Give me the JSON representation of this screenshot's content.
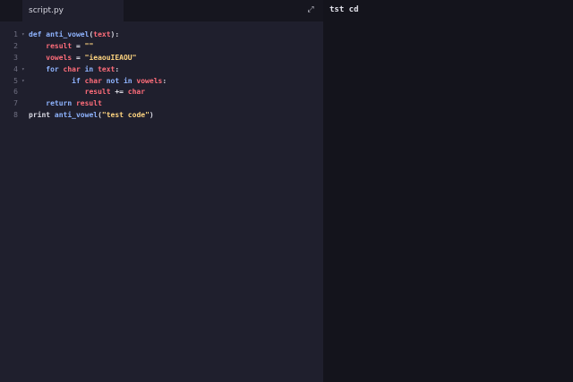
{
  "editor": {
    "tab_label": "script.py",
    "lines": [
      {
        "num": "1",
        "fold": "▾",
        "indent": 0,
        "tokens": [
          {
            "t": "def ",
            "c": "kw"
          },
          {
            "t": "anti_vowel",
            "c": "fn"
          },
          {
            "t": "(",
            "c": "plain"
          },
          {
            "t": "text",
            "c": "var"
          },
          {
            "t": "):",
            "c": "plain"
          }
        ]
      },
      {
        "num": "2",
        "fold": "",
        "indent": 4,
        "tokens": [
          {
            "t": "result",
            "c": "var"
          },
          {
            "t": " = ",
            "c": "op"
          },
          {
            "t": "\"\"",
            "c": "str"
          }
        ]
      },
      {
        "num": "3",
        "fold": "",
        "indent": 4,
        "tokens": [
          {
            "t": "vowels",
            "c": "var"
          },
          {
            "t": " = ",
            "c": "op"
          },
          {
            "t": "\"ieaouIEAOU\"",
            "c": "str"
          }
        ]
      },
      {
        "num": "4",
        "fold": "▾",
        "indent": 4,
        "tokens": [
          {
            "t": "for ",
            "c": "kw"
          },
          {
            "t": "char",
            "c": "var"
          },
          {
            "t": " in ",
            "c": "kw"
          },
          {
            "t": "text",
            "c": "var"
          },
          {
            "t": ":",
            "c": "plain"
          }
        ]
      },
      {
        "num": "5",
        "fold": "▾",
        "indent": 10,
        "tokens": [
          {
            "t": "if ",
            "c": "kw"
          },
          {
            "t": "char",
            "c": "var"
          },
          {
            "t": " not in ",
            "c": "kw"
          },
          {
            "t": "vowels",
            "c": "var"
          },
          {
            "t": ":",
            "c": "plain"
          }
        ]
      },
      {
        "num": "6",
        "fold": "",
        "indent": 13,
        "tokens": [
          {
            "t": "result",
            "c": "var"
          },
          {
            "t": " += ",
            "c": "op"
          },
          {
            "t": "char",
            "c": "var"
          }
        ]
      },
      {
        "num": "7",
        "fold": "",
        "indent": 4,
        "tokens": [
          {
            "t": "return ",
            "c": "kw"
          },
          {
            "t": "result",
            "c": "var"
          }
        ]
      },
      {
        "num": "8",
        "fold": "",
        "indent": 0,
        "tokens": [
          {
            "t": "print ",
            "c": "plain"
          },
          {
            "t": "anti_vowel",
            "c": "fn"
          },
          {
            "t": "(",
            "c": "plain"
          },
          {
            "t": "\"test code\"",
            "c": "str"
          },
          {
            "t": ")",
            "c": "plain"
          }
        ]
      }
    ]
  },
  "icons": {
    "expand": "expand-icon"
  },
  "console": {
    "output": "tst cd"
  },
  "colors": {
    "editor_bg": "#1f1f2d",
    "console_bg": "#14141c",
    "keyword": "#8fb4ff",
    "variable": "#ff6d7a",
    "string": "#ffd580"
  }
}
